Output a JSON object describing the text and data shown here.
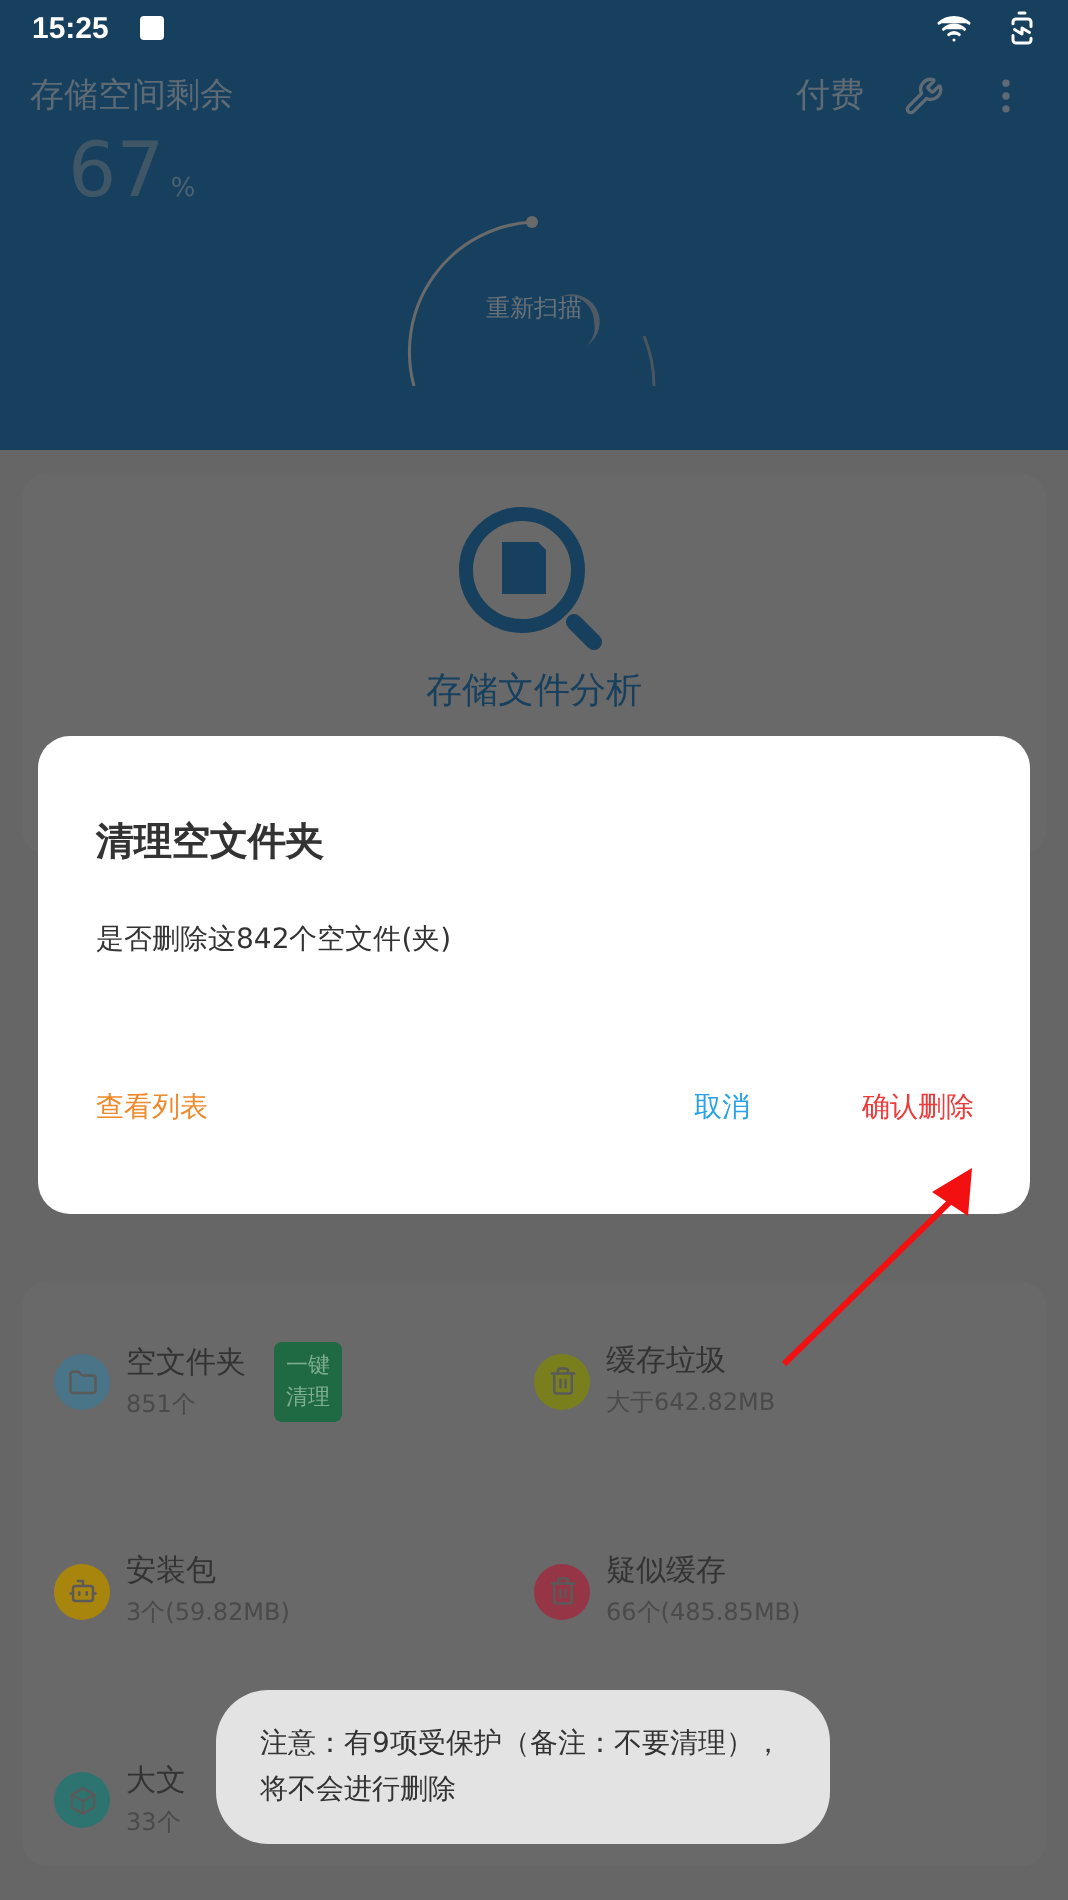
{
  "status_bar": {
    "time": "15:25"
  },
  "header": {
    "title": "存储空间剩余",
    "percent": "67",
    "percent_unit": "%",
    "pay": "付费",
    "rescan": "重新扫描"
  },
  "analysis_card": {
    "label": "存储文件分析"
  },
  "categories": [
    {
      "name": "空文件夹",
      "detail": "851个",
      "color": "#4a7488",
      "kind": "folder",
      "action": "一键清理"
    },
    {
      "name": "缓存垃圾",
      "detail": "大于642.82MB",
      "color": "#7a7f1e",
      "kind": "trash"
    },
    {
      "name": "安装包",
      "detail": "3个(59.82MB)",
      "color": "#a8860e",
      "kind": "android"
    },
    {
      "name": "疑似缓存",
      "detail": "66个(485.85MB)",
      "color": "#963546",
      "kind": "trash"
    },
    {
      "name": "大文",
      "detail": "33个",
      "color": "#2d7470",
      "kind": "box"
    }
  ],
  "dialog": {
    "title": "清理空文件夹",
    "message": "是否删除这842个空文件(夹)",
    "buttons": [
      {
        "label": "查看列表",
        "kind": "neutral"
      },
      {
        "label": "取消",
        "kind": "cancel"
      },
      {
        "label": "确认删除",
        "kind": "confirm"
      }
    ]
  },
  "toast": {
    "text": "注意：有9项受保护（备注：不要清理），将不会进行删除"
  }
}
